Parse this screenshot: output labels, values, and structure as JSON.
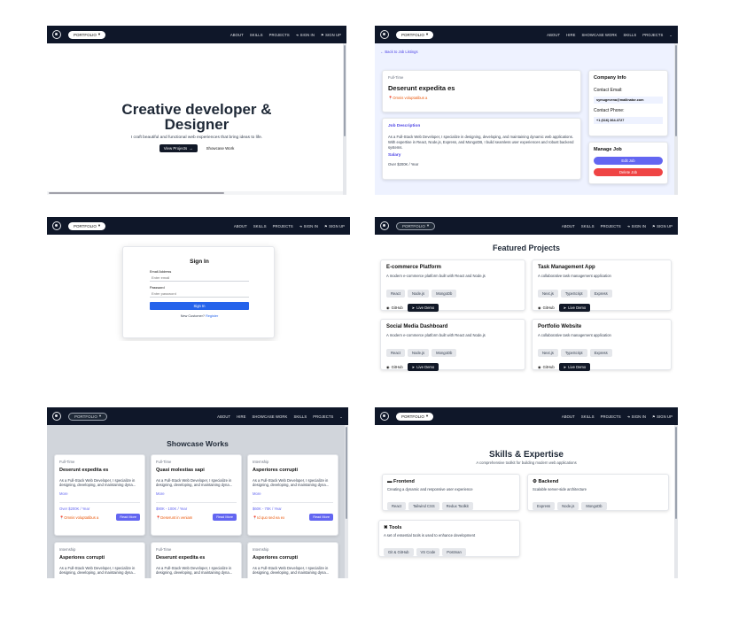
{
  "nav": {
    "brand": "PORTFOLIO",
    "links_a": [
      "ABOUT",
      "SKILLS",
      "PROJECTS",
      "SIGN IN",
      "SIGN UP"
    ],
    "links_b": [
      "ABOUT",
      "HIRE",
      "SHOWCASE WORK",
      "SKILLS",
      "PROJECTS"
    ],
    "links_c": [
      "ABOUT",
      "SKILLS",
      "PROJECTS",
      "SIGN IN",
      "SIGN UP"
    ],
    "links_d": [
      "ABOUT",
      "HIRE",
      "SHOWCASE WORK",
      "SKILLS",
      "PROJECTS"
    ]
  },
  "hero": {
    "title_line1": "Creative developer &",
    "title_line2": "Designer",
    "subtitle": "I craft beautiful and functional web experiences that bring ideas to life.",
    "primary_cta": "View Projects",
    "secondary_cta": "Showcase Work"
  },
  "job": {
    "back": "Back to Job Listings",
    "type": "Full-Time",
    "title": "Deserunt expedita es",
    "location": "Omnis voluptatibus a",
    "desc_heading": "Job Description",
    "desc": "As a Full-Stack Web Developer, I specialize in designing, developing, and maintaining dynamic web applications. With expertise in React, Node.js, Express, and MongoDB, I build seamless user experiences and robust backend systems.",
    "salary_heading": "Salary",
    "salary": "Over $200K / Year",
    "company_heading": "Company Info",
    "email_label": "Contact Email:",
    "email": "symugevena@mailinator.com",
    "phone_label": "Contact Phone:",
    "phone": "+1 (616) 364-3727",
    "manage_heading": "Manage Job",
    "edit": "Edit Job",
    "delete": "Delete Job"
  },
  "signin": {
    "title": "Sign In",
    "email_label": "Email Address",
    "email_placeholder": "Enter email",
    "password_label": "Password",
    "password_placeholder": "Enter password",
    "submit": "Sign In",
    "new_customer": "New Customer?",
    "register": "Register"
  },
  "projects": {
    "title": "Featured Projects",
    "github": "GitHub",
    "demo": "Live Demo",
    "items": [
      {
        "name": "E-commerce Platform",
        "desc": "A modern e-commerce platform built with React and Node.js",
        "tags": [
          "React",
          "Node.js",
          "MongoDb"
        ]
      },
      {
        "name": "Task Management App",
        "desc": "A collaborative task management application",
        "tags": [
          "Next.js",
          "TypeScript",
          "Express"
        ]
      },
      {
        "name": "Social Media Dashboard",
        "desc": "A modern e-commerce platform built with React and Node.js",
        "tags": [
          "React",
          "Node.js",
          "MongoDb"
        ]
      },
      {
        "name": "Portfolio Website",
        "desc": "A collaborative task management application",
        "tags": [
          "Next.js",
          "TypeScript",
          "Express"
        ]
      }
    ]
  },
  "showcase": {
    "title": "Showcase Works",
    "more": "More",
    "read_more": "Read More",
    "desc": "As a Full-Stack Web Developer, I specialize in designing, developing, and maintaining dyna...",
    "items": [
      {
        "type": "Full-Time",
        "title": "Deserunt expedita es",
        "salary": "Over $200K / Year",
        "location": "Omnis voluptatibus a"
      },
      {
        "type": "Full-Time",
        "title": "Quasi molestias sapi",
        "salary": "$90K - 100K / Year",
        "location": "Deserunt in veniam"
      },
      {
        "type": "Internship",
        "title": "Asperiores corrupti",
        "salary": "$60K - 70K / Year",
        "location": "Id quo sed ea ex"
      },
      {
        "type": "Internship",
        "title": "Asperiores corrupti"
      },
      {
        "type": "Full-Time",
        "title": "Deserunt expedita es"
      },
      {
        "type": "Internship",
        "title": "Asperiores corrupti"
      }
    ]
  },
  "skills": {
    "title": "Skills & Expertise",
    "subtitle": "A comprehensive toolkit for building modern web applications",
    "groups": [
      {
        "name": "Frontend",
        "desc": "Creating a dynamic and responsive user experience",
        "tags": [
          "React",
          "Tailwind CSS",
          "Redux Toolkit"
        ]
      },
      {
        "name": "Backend",
        "desc": "Scalable server-side architecture",
        "tags": [
          "Express",
          "Node.js",
          "MongoDb"
        ]
      },
      {
        "name": "Tools",
        "desc": "A set of essential tools is used to enhance development",
        "tags": [
          "Git & GitHub",
          "VS Code",
          "Postman"
        ]
      }
    ]
  },
  "colors": {
    "nav": "#0f1729",
    "accent": "#6366f1",
    "danger": "#ef4444",
    "primary": "#2563eb"
  }
}
